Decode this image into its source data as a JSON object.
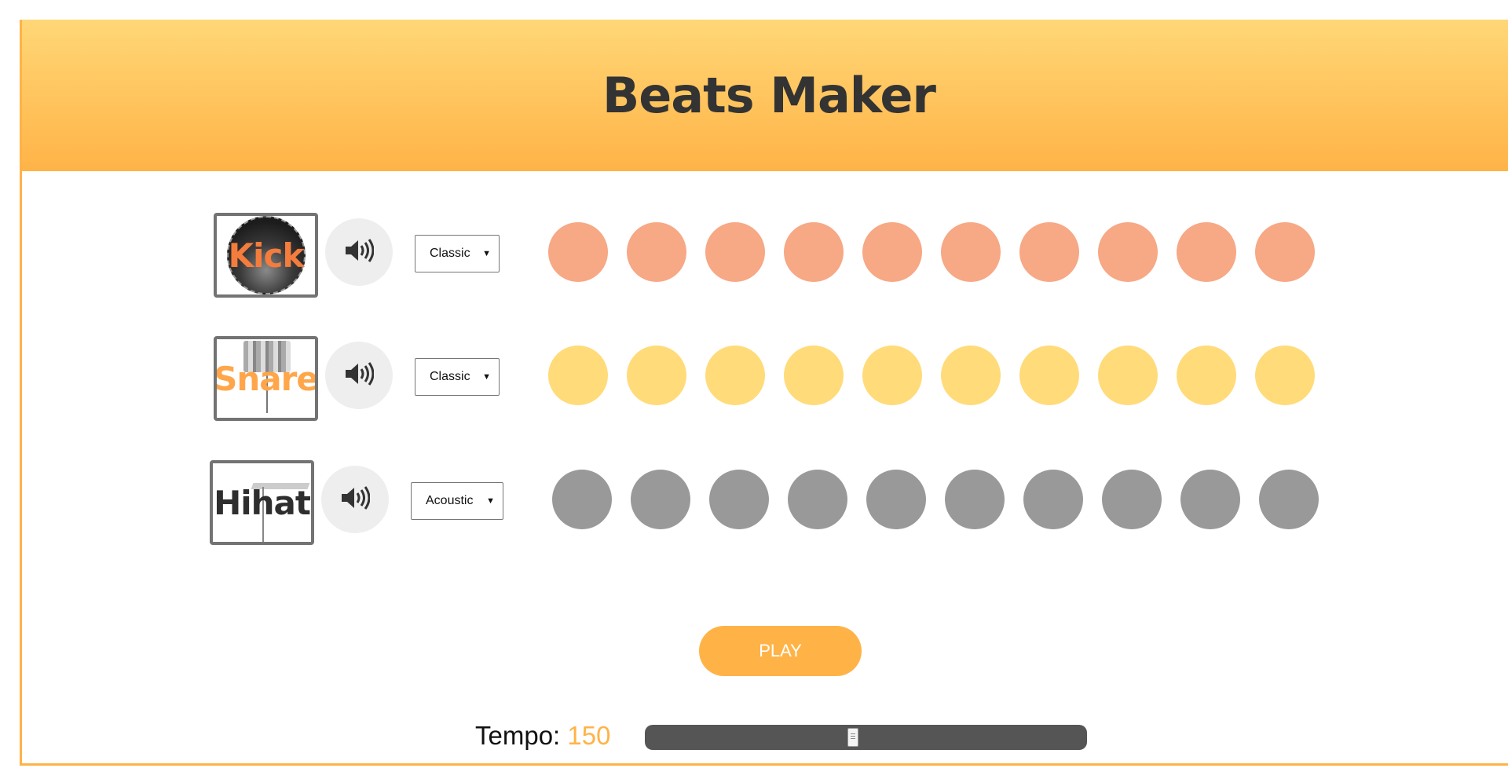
{
  "app": {
    "title": "Beats Maker"
  },
  "colors": {
    "accent": "#ffb347",
    "header_top": "#ffd777",
    "kick_beat": "#f7a885",
    "snare_beat": "#ffdb7a",
    "hihat_beat": "#999999",
    "kick_label": "#f47c3c",
    "snare_label": "#ffa64a",
    "hihat_label": "#2e2e2e"
  },
  "tracks": [
    {
      "id": "kick",
      "pad_label": "Kick",
      "mute_icon": "speaker-icon",
      "sound_select": "Classic",
      "beat_count": 10
    },
    {
      "id": "snare",
      "pad_label": "Snare",
      "mute_icon": "speaker-icon",
      "sound_select": "Classic",
      "beat_count": 10
    },
    {
      "id": "hihat",
      "pad_label": "Hihat",
      "mute_icon": "speaker-icon",
      "sound_select": "Acoustic",
      "beat_count": 10
    }
  ],
  "controls": {
    "play_label": "PLAY",
    "tempo_label": "Tempo:",
    "tempo_value": "150",
    "tempo_fraction": 0.47
  }
}
